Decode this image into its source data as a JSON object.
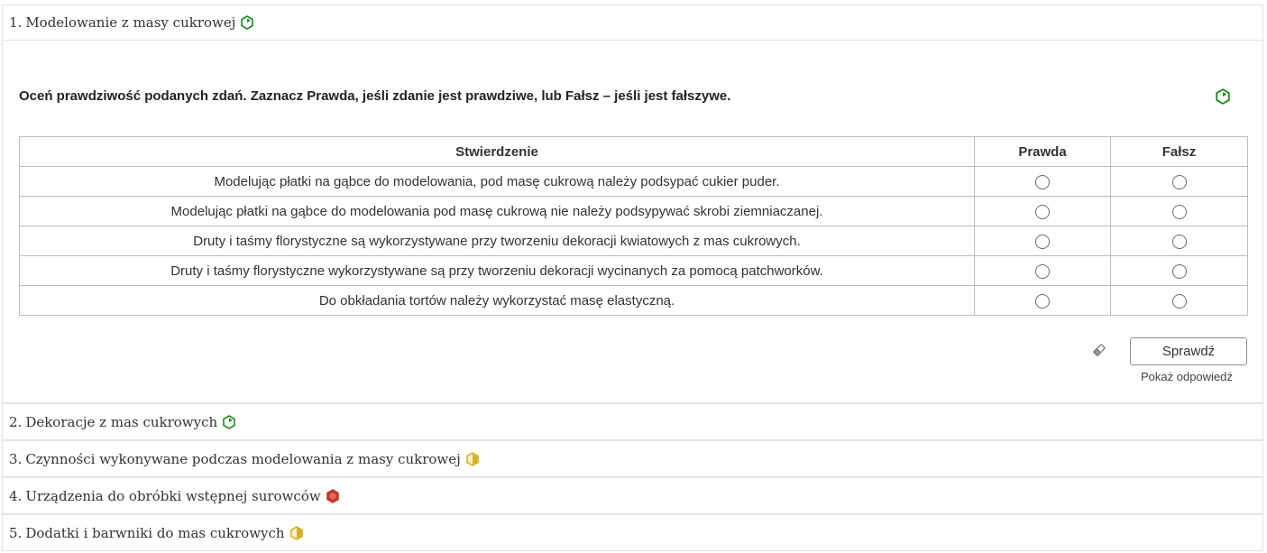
{
  "sections": [
    {
      "number": "1.",
      "title": "Modelowanie z masy cukrowej",
      "status_icon": "hexagon-green-progress-icon",
      "status_color": "#1a8a1a"
    },
    {
      "number": "2.",
      "title": "Dekoracje z mas cukrowych",
      "status_icon": "hexagon-green-progress-icon",
      "status_color": "#1a8a1a"
    },
    {
      "number": "3.",
      "title": "Czynności wykonywane podczas modelowania z masy cukrowej",
      "status_icon": "hexagon-yellow-half-icon",
      "status_color": "#d4b12a"
    },
    {
      "number": "4.",
      "title": "Urządzenia do obróbki wstępnej surowców",
      "status_icon": "hexagon-red-full-icon",
      "status_color": "#c0392b"
    },
    {
      "number": "5.",
      "title": "Dodatki i barwniki do mas cukrowych",
      "status_icon": "hexagon-yellow-half-icon",
      "status_color": "#d4b12a"
    }
  ],
  "exercise": {
    "instruction": "Oceń prawdziwość podanych zdań. Zaznacz Prawda, jeśli zdanie jest prawdziwe, lub Fałsz – jeśli jest fałszywe.",
    "instruction_icon": "hexagon-green-progress-icon",
    "columns": [
      "Stwierdzenie",
      "Prawda",
      "Fałsz"
    ],
    "rows": [
      "Modelując płatki na gąbce do modelowania, pod masę cukrową należy podsypać cukier puder.",
      "Modelując płatki na gąbce do modelowania pod masę cukrową nie należy podsypywać skrobi ziemniaczanej.",
      "Druty i taśmy florystyczne są wykorzystywane przy tworzeniu dekoracji kwiatowych z mas cukrowych.",
      "Druty i taśmy florystyczne wykorzystywane są przy tworzeniu dekoracji wycinanych za pomocą patchworków.",
      "Do obkładania tortów należy wykorzystać masę elastyczną."
    ],
    "check_label": "Sprawdź",
    "show_answer_label": "Pokaż odpowiedź",
    "reset_icon": "eraser-icon"
  }
}
